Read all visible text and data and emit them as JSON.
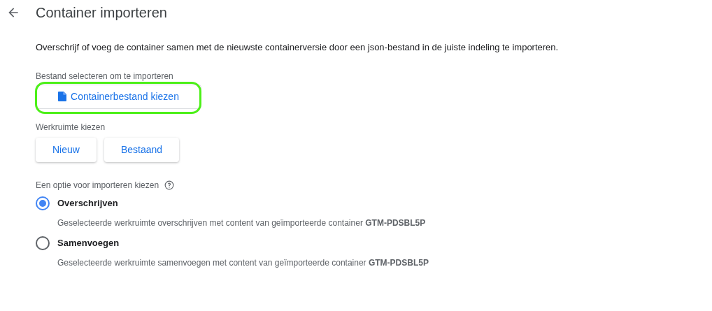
{
  "header": {
    "title": "Container importeren"
  },
  "description": "Overschrijf of voeg de container samen met de nieuwste containerversie door een json-bestand in de juiste indeling te importeren.",
  "file_section": {
    "label": "Bestand selecteren om te importeren",
    "button": "Containerbestand kiezen",
    "highlighted": true
  },
  "workspace_section": {
    "label": "Werkruimte kiezen",
    "buttons": [
      "Nieuw",
      "Bestaand"
    ]
  },
  "import_options": {
    "label": "Een optie voor importeren kiezen",
    "options": [
      {
        "title": "Overschrijven",
        "description": "Geselecteerde werkruimte overschrijven met content van geïmporteerde container **GTM-PDSBL5P**",
        "selected": true
      },
      {
        "title": "Samenvoegen",
        "description": "Geselecteerde werkruimte samenvoegen met content van geïmporteerde container **GTM-PDSBL5P**",
        "selected": false
      }
    ]
  }
}
